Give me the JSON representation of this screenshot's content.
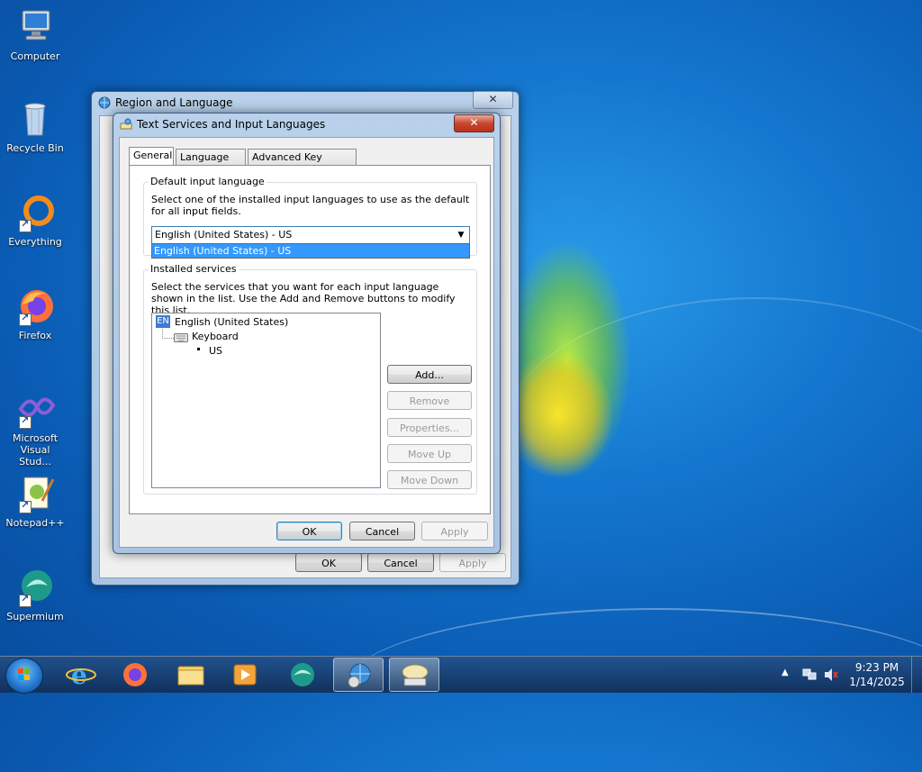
{
  "desktop": {
    "icons": [
      {
        "label": "Computer",
        "icon": "computer-icon"
      },
      {
        "label": "Recycle Bin",
        "icon": "recycle-bin-icon"
      },
      {
        "label": "Everything",
        "icon": "everything-icon"
      },
      {
        "label": "Firefox",
        "icon": "firefox-icon"
      },
      {
        "label": "Microsoft Visual Stud...",
        "icon": "visual-studio-icon"
      },
      {
        "label": "Notepad++",
        "icon": "notepadpp-icon"
      },
      {
        "label": "Supermium",
        "icon": "supermium-icon"
      }
    ]
  },
  "region_window": {
    "title": "Region and Language",
    "close": "✕",
    "ok": "OK",
    "cancel": "Cancel",
    "apply": "Apply"
  },
  "text_services_dialog": {
    "title": "Text Services and Input Languages",
    "close": "✕",
    "tabs": [
      {
        "label": "General",
        "active": true
      },
      {
        "label": "Language Bar",
        "active": false
      },
      {
        "label": "Advanced Key Settings",
        "active": false
      }
    ],
    "default_input": {
      "legend": "Default input language",
      "description": "Select one of the installed input languages to use as the default for all input fields.",
      "selected": "English (United States) - US",
      "options": [
        "English (United States) - US"
      ]
    },
    "installed_services": {
      "legend": "Installed services",
      "description": "Select the services that you want for each input language shown in the list. Use the Add and Remove buttons to modify this list.",
      "tree": {
        "language_badge": "EN",
        "language": "English (United States)",
        "category": "Keyboard",
        "layout": "US"
      },
      "buttons": {
        "add": "Add...",
        "remove": "Remove",
        "properties": "Properties...",
        "move_up": "Move Up",
        "move_down": "Move Down"
      }
    },
    "ok": "OK",
    "cancel": "Cancel",
    "apply": "Apply"
  },
  "taskbar": {
    "pinned": [
      "internet-explorer-icon",
      "firefox-icon",
      "file-explorer-icon",
      "media-player-icon",
      "supermium-icon",
      "control-panel-icon",
      "text-services-icon"
    ],
    "clock_time": "9:23 PM",
    "clock_date": "1/14/2025"
  },
  "colors": {
    "selection": "#3399ff",
    "wallpaper": "#1477cf"
  }
}
